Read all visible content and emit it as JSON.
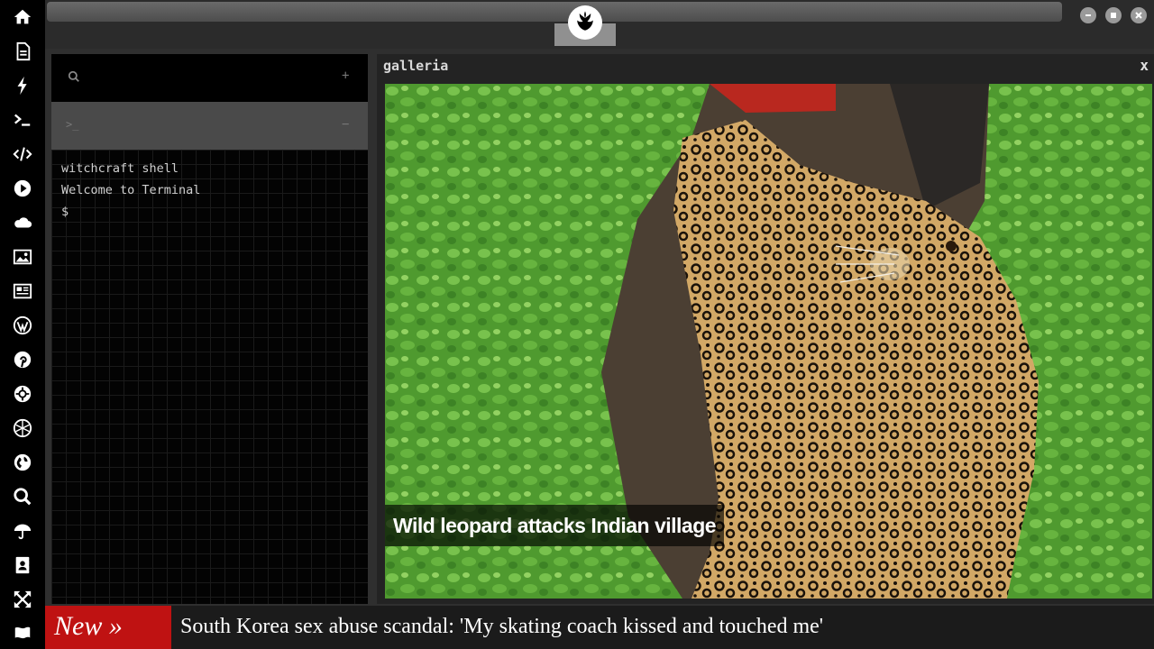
{
  "dock": {
    "items": [
      "home-icon",
      "document-icon",
      "bolt-icon",
      "terminal-icon",
      "code-icon",
      "play-icon",
      "cloud-icon",
      "image-icon",
      "newspaper-icon",
      "wordpress-icon",
      "pinterest-icon",
      "cog-badge-icon",
      "globe-mesh-icon",
      "globe-icon",
      "search-icon",
      "umbrella-icon",
      "contacts-icon",
      "expand-icon",
      "flag-icon"
    ]
  },
  "window": {
    "logo": "rebel-alliance-icon",
    "controls": [
      "minimize-icon",
      "maximize-icon",
      "close-icon"
    ]
  },
  "terminal": {
    "search_icon": "search-icon",
    "add_label": "+",
    "tab_prompt": ">_",
    "tab_minus": "−",
    "lines": [
      "witchcraft shell",
      "Welcome to Terminal",
      "$"
    ]
  },
  "galleria": {
    "title": "galleria",
    "close_label": "x",
    "caption": "Wild leopard attacks Indian village"
  },
  "ticker": {
    "badge": "New »",
    "headline": "South Korea sex abuse scandal: 'My skating coach kissed and touched me'"
  },
  "colors": {
    "dock_bg": "#000000",
    "ticker_badge": "#bf1212",
    "panel_bg": "#232323"
  }
}
